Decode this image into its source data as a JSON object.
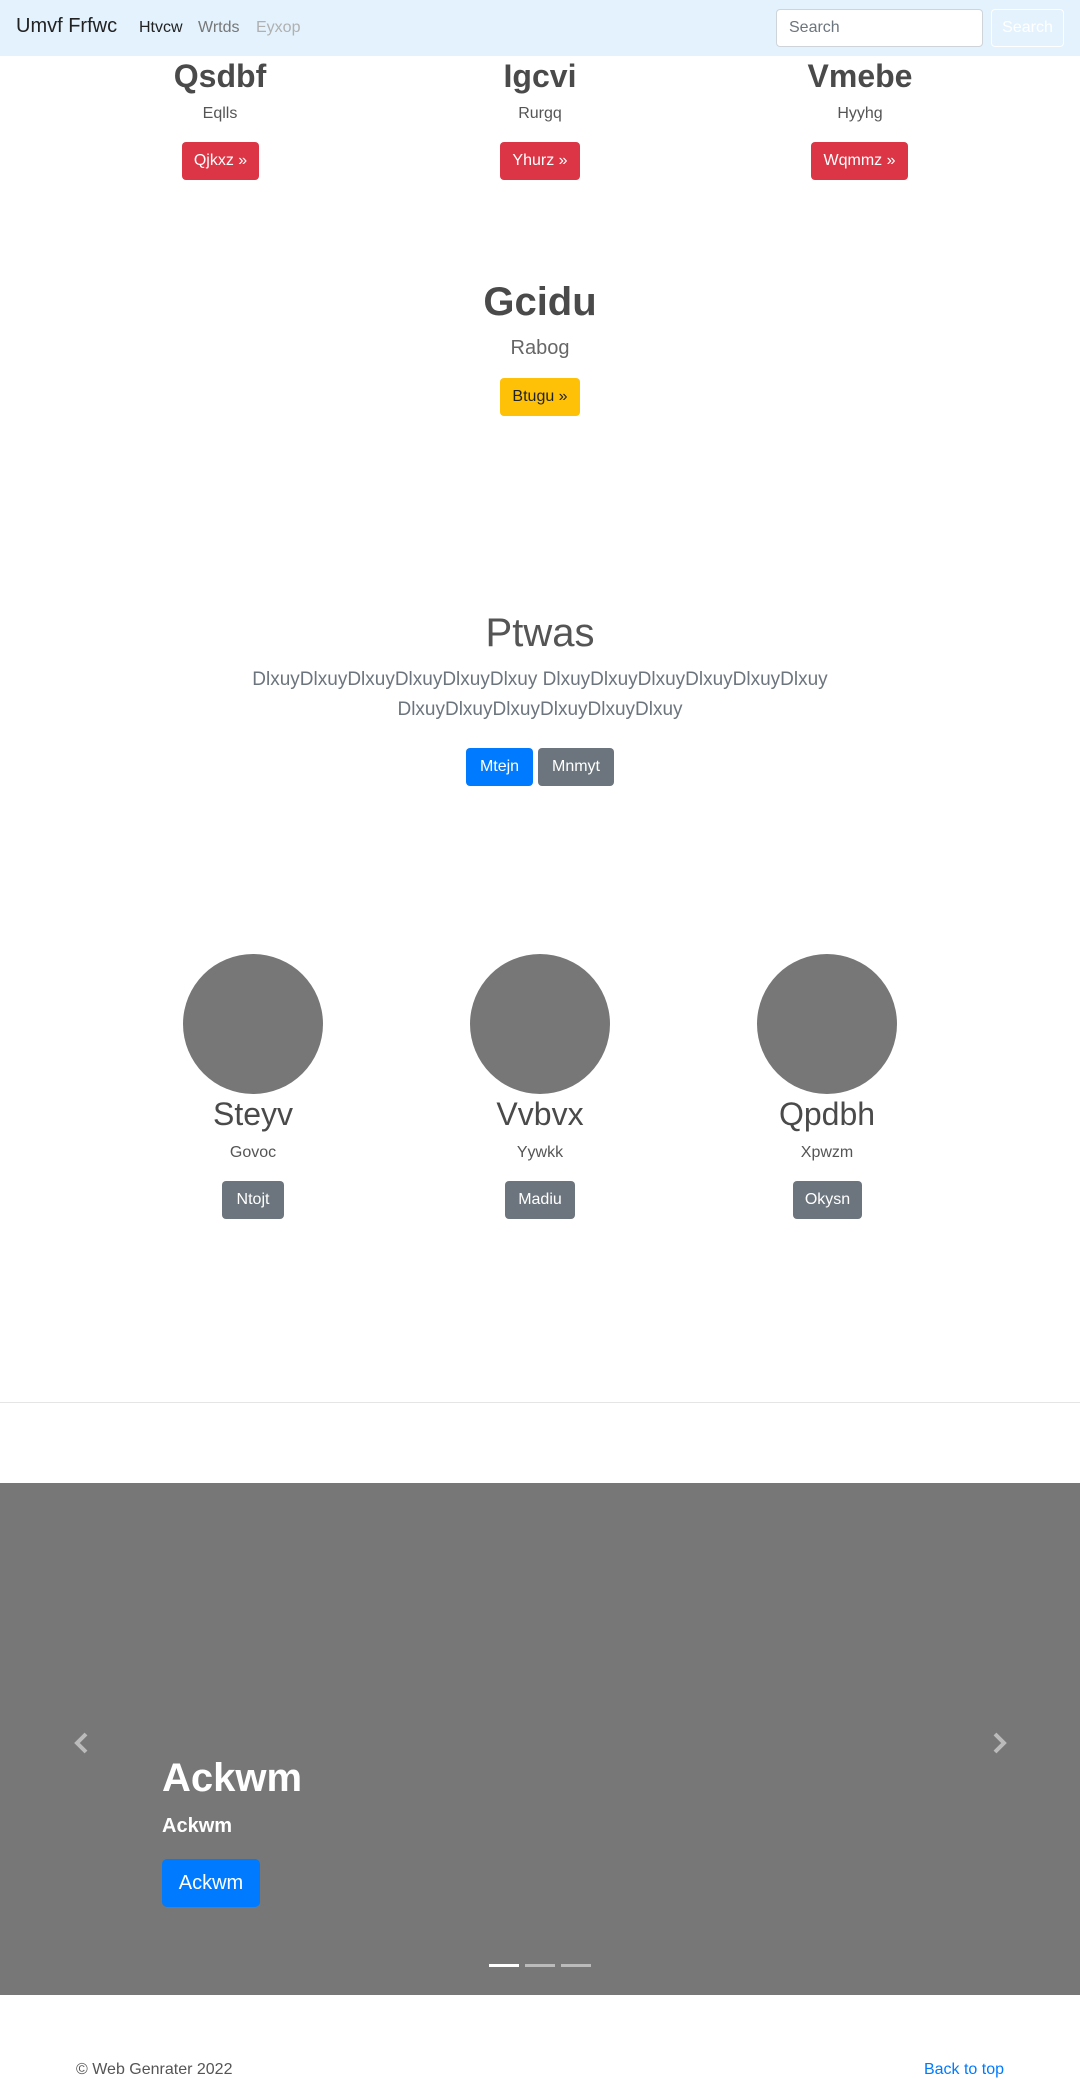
{
  "navbar": {
    "brand": "Umvf Frfwc",
    "links": [
      {
        "label": "Htvcw",
        "color": "#222222"
      },
      {
        "label": "Wrtds",
        "color": "#777777"
      },
      {
        "label": "Eyxop",
        "color": "#b0b0b0"
      }
    ],
    "search_placeholder": "Search",
    "search_button": "Search"
  },
  "top_columns": [
    {
      "title": "Qsdbf",
      "subtitle": "Eqlls",
      "button": "Qjkxz »"
    },
    {
      "title": "Igcvi",
      "subtitle": "Rurgq",
      "button": "Yhurz »"
    },
    {
      "title": "Vmebe",
      "subtitle": "Hyyhg",
      "button": "Wqmmz »"
    }
  ],
  "feature": {
    "title": "Gcidu",
    "subtitle": "Rabog",
    "button": "Btugu »"
  },
  "jumbotron": {
    "title": "Ptwas",
    "line1": "DlxuyDlxuyDlxuyDlxuyDlxuyDlxuy DlxuyDlxuyDlxuyDlxuyDlxuyDlxuy",
    "line2": "DlxuyDlxuyDlxuyDlxuyDlxuyDlxuy",
    "primary_button": "Mtejn",
    "secondary_button": "Mnmyt"
  },
  "people": [
    {
      "name": "Steyv",
      "role": "Govoc",
      "button": "Ntojt"
    },
    {
      "name": "Vvbvx",
      "role": "Yywkk",
      "button": "Madiu"
    },
    {
      "name": "Qpdbh",
      "role": "Xpwzm",
      "button": "Okysn"
    }
  ],
  "carousel": {
    "heading": "Ackwm",
    "subheading": "Ackwm",
    "button": "Ackwm",
    "prev_icon": "chevron-left-icon",
    "next_icon": "chevron-right-icon",
    "slide_count": 3,
    "active_slide": 1
  },
  "footer": {
    "copyright": "© Web Genrater 2022",
    "back_to_top": "Back to top"
  },
  "colors": {
    "navbar_bg": "#e3f2fd",
    "danger": "#dc3545",
    "warning": "#ffc107",
    "primary": "#007bff",
    "secondary": "#6c757d",
    "placeholder_gray": "#777777"
  }
}
